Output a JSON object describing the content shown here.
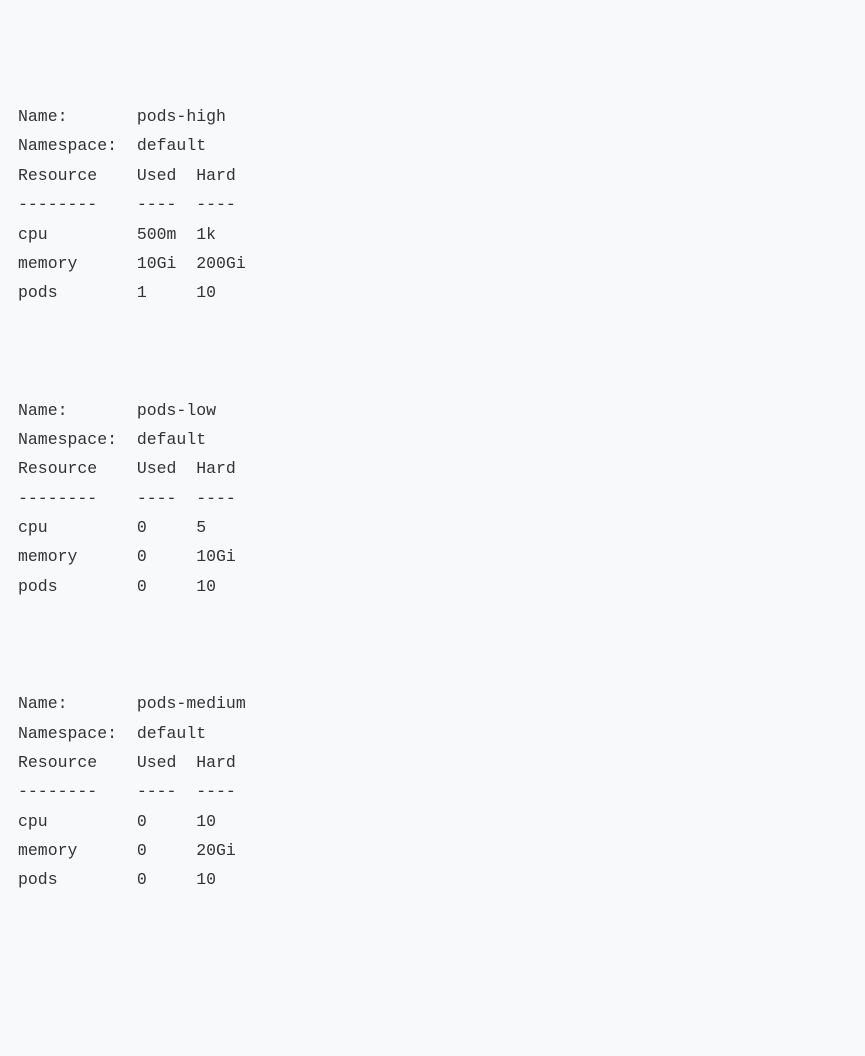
{
  "labels": {
    "name": "Name:",
    "namespace": "Namespace:",
    "resource": "Resource",
    "used": "Used",
    "hard": "Hard",
    "divider_c1": "--------",
    "divider_c2": "----",
    "divider_c3": "----"
  },
  "quotas": [
    {
      "name": "pods-high",
      "namespace": "default",
      "rows": [
        {
          "resource": "cpu",
          "used": "500m",
          "hard": "1k"
        },
        {
          "resource": "memory",
          "used": "10Gi",
          "hard": "200Gi"
        },
        {
          "resource": "pods",
          "used": "1",
          "hard": "10"
        }
      ]
    },
    {
      "name": "pods-low",
      "namespace": "default",
      "rows": [
        {
          "resource": "cpu",
          "used": "0",
          "hard": "5"
        },
        {
          "resource": "memory",
          "used": "0",
          "hard": "10Gi"
        },
        {
          "resource": "pods",
          "used": "0",
          "hard": "10"
        }
      ]
    },
    {
      "name": "pods-medium",
      "namespace": "default",
      "rows": [
        {
          "resource": "cpu",
          "used": "0",
          "hard": "10"
        },
        {
          "resource": "memory",
          "used": "0",
          "hard": "20Gi"
        },
        {
          "resource": "pods",
          "used": "0",
          "hard": "10"
        }
      ]
    }
  ]
}
